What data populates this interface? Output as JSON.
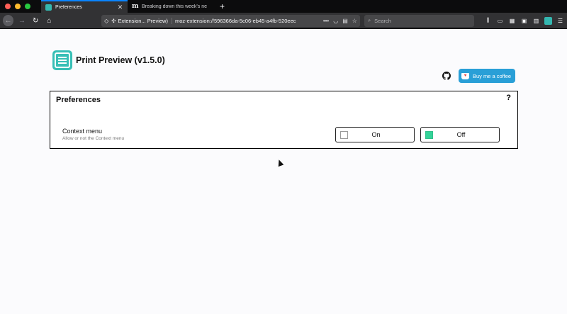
{
  "tabs": [
    {
      "label": "Preferences",
      "active": true,
      "favicon": "print-preview-icon"
    },
    {
      "label": "Breaking down this week's ne",
      "active": false,
      "favicon": "m-logo-icon"
    }
  ],
  "navbar": {
    "identity_label": "Extension... Preview)",
    "url": "moz-extension://596366da-5c06-eb45-a4fb-520eec",
    "search_placeholder": "Search"
  },
  "page": {
    "app_title": "Print Preview (v1.5.0)",
    "coffee_label": "Buy me a coffee",
    "prefs_title": "Preferences",
    "help_mark": "?",
    "option": {
      "label": "Context menu",
      "description": "Allow or not the Context menu",
      "on_label": "On",
      "off_label": "Off",
      "selected": "Off"
    }
  },
  "colors": {
    "accent": "#34b7b0",
    "coffee": "#299fd7",
    "checked": "#34d399"
  }
}
